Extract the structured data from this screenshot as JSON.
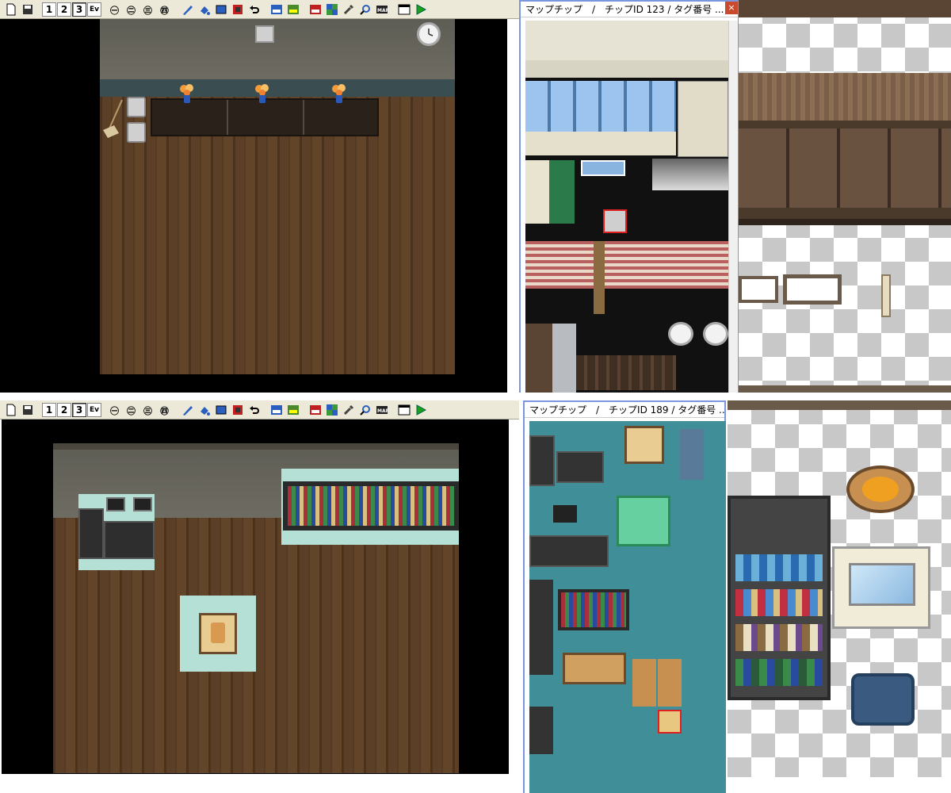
{
  "toolbar": {
    "layer_buttons": [
      "1",
      "2",
      "3",
      "Ev"
    ],
    "active_layer": "3"
  },
  "top": {
    "palette_title": "マップチップ　/　チップID 123 / タグ番号 ...",
    "close_label": "×"
  },
  "bottom": {
    "palette_title": "マップチップ　/　チップID 189 / タグ番号 ..."
  },
  "icons": [
    "new-file-icon",
    "save-icon",
    "layer-1-icon",
    "layer-2-icon",
    "layer-3-icon",
    "event-layer-icon",
    "pen-tool-icon",
    "fill-tool-icon",
    "rect-tool-icon",
    "select-tool-icon",
    "undo-icon",
    "database-icon",
    "settings-icon",
    "test-play-icon"
  ],
  "colors": {
    "accent": "#7a96df",
    "selection": "#e02020",
    "toolbar_bg": "#ece9d8"
  }
}
